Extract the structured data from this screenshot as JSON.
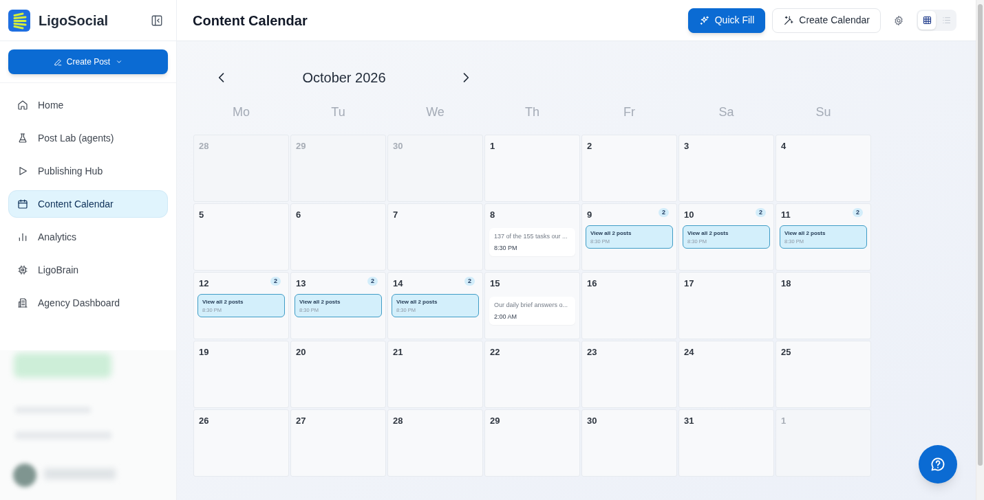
{
  "sidebar": {
    "brand": "LigoSocial",
    "create_button": {
      "label": "Create Post"
    },
    "nav": [
      {
        "label": "Home",
        "selected": false
      },
      {
        "label": "Post Lab (agents)",
        "selected": false
      },
      {
        "label": "Publishing Hub",
        "selected": false
      },
      {
        "label": "Content Calendar",
        "selected": true
      },
      {
        "label": "Analytics",
        "selected": false
      },
      {
        "label": "LigoBrain",
        "selected": false
      },
      {
        "label": "Agency Dashboard",
        "selected": false
      }
    ]
  },
  "header": {
    "title": "Content Calendar",
    "buttons": [
      {
        "label": "Quick Fill",
        "kind": "primary"
      },
      {
        "label": "Create Calendar",
        "kind": "secondary"
      }
    ],
    "views": [
      {
        "kind": "grid",
        "selected": true
      },
      {
        "kind": "list",
        "selected": false
      }
    ]
  },
  "calendar": {
    "month": "October 2026",
    "weekdays": [
      "Mo",
      "Tu",
      "We",
      "Th",
      "Fr",
      "Sa",
      "Su"
    ],
    "weeks": [
      [
        {
          "day": "28",
          "in_month": false
        },
        {
          "day": "29",
          "in_month": false
        },
        {
          "day": "30",
          "in_month": false
        },
        {
          "day": "1",
          "in_month": true
        },
        {
          "day": "2",
          "in_month": true
        },
        {
          "day": "3",
          "in_month": true
        },
        {
          "day": "4",
          "in_month": true
        }
      ],
      [
        {
          "day": "5",
          "in_month": true
        },
        {
          "day": "6",
          "in_month": true
        },
        {
          "day": "7",
          "in_month": true
        },
        {
          "day": "8",
          "in_month": true,
          "posts": [
            {
              "kind": "single",
              "text": "137 of the 155 tasks our ...",
              "time": "8:30 PM"
            }
          ]
        },
        {
          "day": "9",
          "in_month": true,
          "count": "2",
          "posts": [
            {
              "kind": "group",
              "text": "View all 2 posts",
              "time": "8:30 PM"
            }
          ]
        },
        {
          "day": "10",
          "in_month": true,
          "count": "2",
          "posts": [
            {
              "kind": "group",
              "text": "View all 2 posts",
              "time": "8:30 PM"
            }
          ]
        },
        {
          "day": "11",
          "in_month": true,
          "count": "2",
          "posts": [
            {
              "kind": "group",
              "text": "View all 2 posts",
              "time": "8:30 PM"
            }
          ]
        }
      ],
      [
        {
          "day": "12",
          "in_month": true,
          "count": "2",
          "posts": [
            {
              "kind": "group",
              "text": "View all 2 posts",
              "time": "8:30 PM"
            }
          ]
        },
        {
          "day": "13",
          "in_month": true,
          "count": "2",
          "posts": [
            {
              "kind": "group",
              "text": "View all 2 posts",
              "time": "8:30 PM"
            }
          ]
        },
        {
          "day": "14",
          "in_month": true,
          "count": "2",
          "posts": [
            {
              "kind": "group",
              "text": "View all 2 posts",
              "time": "8:30 PM"
            }
          ]
        },
        {
          "day": "15",
          "in_month": true,
          "posts": [
            {
              "kind": "single",
              "text": "Our daily brief answers o...",
              "time": "2:00 AM"
            }
          ]
        },
        {
          "day": "16",
          "in_month": true
        },
        {
          "day": "17",
          "in_month": true
        },
        {
          "day": "18",
          "in_month": true
        }
      ],
      [
        {
          "day": "19",
          "in_month": true
        },
        {
          "day": "20",
          "in_month": true
        },
        {
          "day": "21",
          "in_month": true
        },
        {
          "day": "22",
          "in_month": true
        },
        {
          "day": "23",
          "in_month": true
        },
        {
          "day": "24",
          "in_month": true
        },
        {
          "day": "25",
          "in_month": true
        }
      ],
      [
        {
          "day": "26",
          "in_month": true
        },
        {
          "day": "27",
          "in_month": true
        },
        {
          "day": "28",
          "in_month": true
        },
        {
          "day": "29",
          "in_month": true
        },
        {
          "day": "30",
          "in_month": true
        },
        {
          "day": "31",
          "in_month": true
        },
        {
          "day": "1",
          "in_month": false
        }
      ]
    ]
  }
}
